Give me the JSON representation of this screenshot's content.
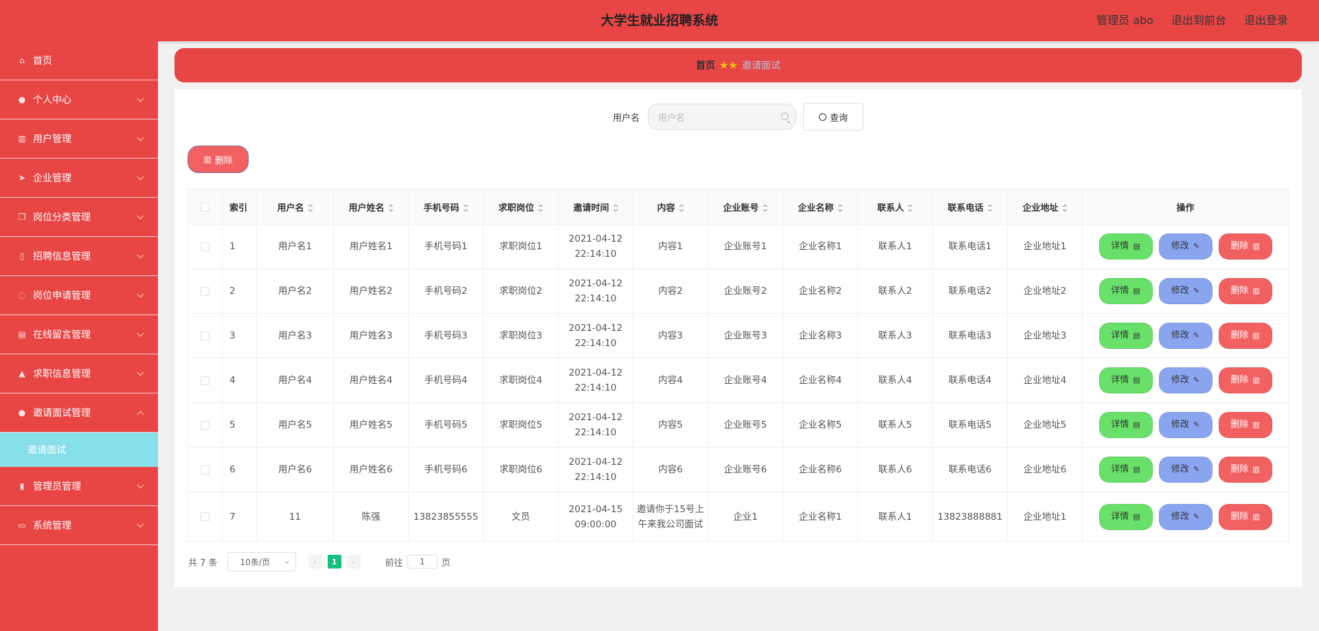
{
  "header": {
    "title": "大学生就业招聘系统",
    "admin_label": "管理员 abo",
    "front_link": "退出到前台",
    "logout_link": "退出登录"
  },
  "sidebar": {
    "items": [
      {
        "label": "首页",
        "icon": "home-icon"
      },
      {
        "label": "个人中心",
        "icon": "user-icon"
      },
      {
        "label": "用户管理",
        "icon": "chart-icon"
      },
      {
        "label": "企业管理",
        "icon": "send-icon"
      },
      {
        "label": "岗位分类管理",
        "icon": "copy-icon"
      },
      {
        "label": "招聘信息管理",
        "icon": "phone-icon"
      },
      {
        "label": "岗位申请管理",
        "icon": "power-icon"
      },
      {
        "label": "在线留言管理",
        "icon": "briefcase-icon"
      },
      {
        "label": "求职信息管理",
        "icon": "thumb-icon"
      },
      {
        "label": "邀请面试管理",
        "icon": "location-icon"
      },
      {
        "label": "管理员管理",
        "icon": "bar-chart-icon"
      },
      {
        "label": "系统管理",
        "icon": "message-icon"
      }
    ],
    "active_sub": "邀请面试"
  },
  "breadcrumb": {
    "home": "首页",
    "current": "邀请面试"
  },
  "search": {
    "label": "用户名",
    "placeholder": "用户名",
    "button": "查询"
  },
  "toolbar": {
    "delete_label": "删除"
  },
  "table": {
    "headers": [
      "索引",
      "用户名",
      "用户姓名",
      "手机号码",
      "求职岗位",
      "邀请时间",
      "内容",
      "企业账号",
      "企业名称",
      "联系人",
      "联系电话",
      "企业地址",
      "操作"
    ],
    "rows": [
      [
        "1",
        "用户名1",
        "用户姓名1",
        "手机号码1",
        "求职岗位1",
        "2021-04-12 22:14:10",
        "内容1",
        "企业账号1",
        "企业名称1",
        "联系人1",
        "联系电话1",
        "企业地址1"
      ],
      [
        "2",
        "用户名2",
        "用户姓名2",
        "手机号码2",
        "求职岗位2",
        "2021-04-12 22:14:10",
        "内容2",
        "企业账号2",
        "企业名称2",
        "联系人2",
        "联系电话2",
        "企业地址2"
      ],
      [
        "3",
        "用户名3",
        "用户姓名3",
        "手机号码3",
        "求职岗位3",
        "2021-04-12 22:14:10",
        "内容3",
        "企业账号3",
        "企业名称3",
        "联系人3",
        "联系电话3",
        "企业地址3"
      ],
      [
        "4",
        "用户名4",
        "用户姓名4",
        "手机号码4",
        "求职岗位4",
        "2021-04-12 22:14:10",
        "内容4",
        "企业账号4",
        "企业名称4",
        "联系人4",
        "联系电话4",
        "企业地址4"
      ],
      [
        "5",
        "用户名5",
        "用户姓名5",
        "手机号码5",
        "求职岗位5",
        "2021-04-12 22:14:10",
        "内容5",
        "企业账号5",
        "企业名称5",
        "联系人5",
        "联系电话5",
        "企业地址5"
      ],
      [
        "6",
        "用户名6",
        "用户姓名6",
        "手机号码6",
        "求职岗位6",
        "2021-04-12 22:14:10",
        "内容6",
        "企业账号6",
        "企业名称6",
        "联系人6",
        "联系电话6",
        "企业地址6"
      ],
      [
        "7",
        "11",
        "陈强",
        "13823855555",
        "文员",
        "2021-04-15 09:00:00",
        "邀请你于15号上午来我公司面试",
        "企业1",
        "企业名称1",
        "联系人1",
        "13823888881",
        "企业地址1"
      ]
    ],
    "actions": {
      "detail": "详情",
      "edit": "修改",
      "delete": "删除"
    }
  },
  "pagination": {
    "total": "共 7 条",
    "page_size": "10条/页",
    "current_page": "1",
    "goto_label": "前往",
    "goto_value": "1",
    "page_suffix": "页"
  },
  "colors": {
    "primary": "#e84545",
    "active_sub_bg": "#87dfe9",
    "detail_btn": "#69e06a",
    "edit_btn": "#8aa5f0",
    "delete_btn": "#f26161",
    "page_active": "#13c07f"
  }
}
